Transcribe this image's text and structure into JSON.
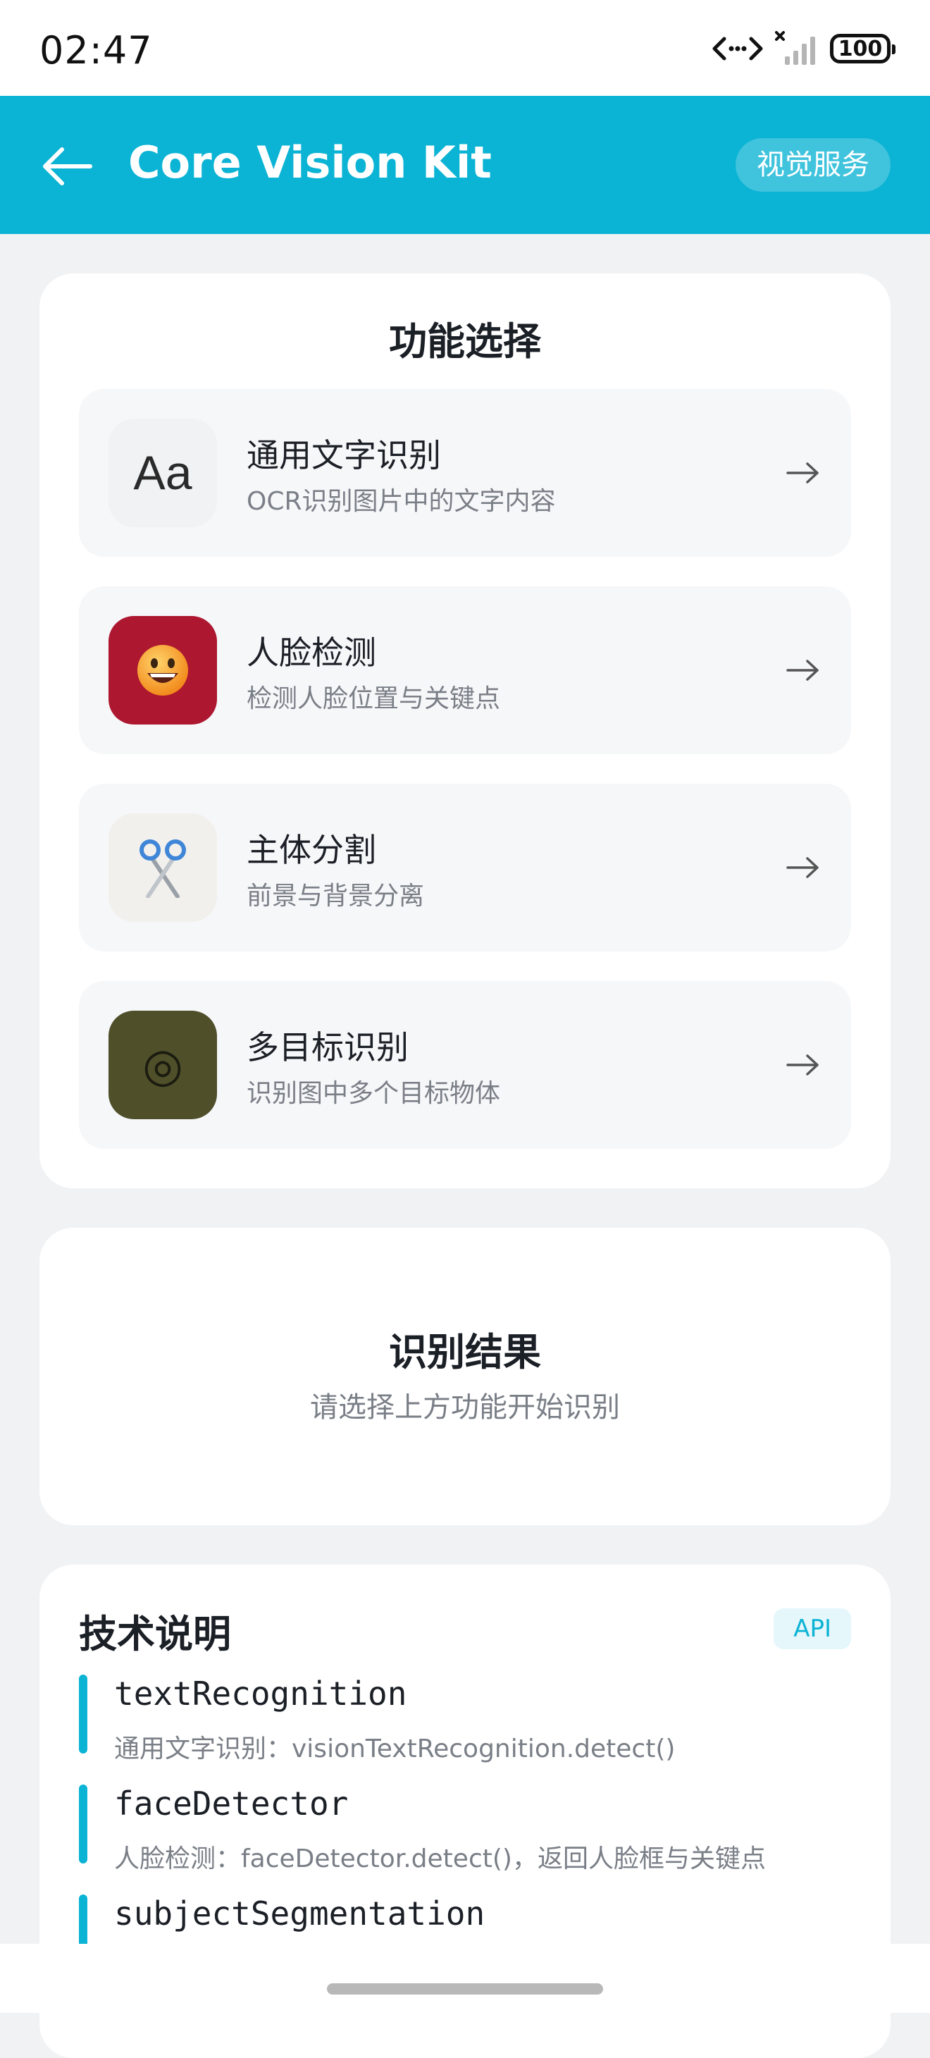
{
  "status_bar": {
    "time": "02:47",
    "battery": "100"
  },
  "header": {
    "title": "Core Vision Kit",
    "badge": "视觉服务"
  },
  "functions": {
    "title": "功能选择",
    "items": [
      {
        "label": "通用文字识别",
        "desc": "OCR识别图片中的文字内容",
        "icon_text": "Aa",
        "icon": "text-aa-icon",
        "icon_bg": "#f1f2f4"
      },
      {
        "label": "人脸检测",
        "desc": "检测人脸位置与关键点",
        "icon": "grinning-face-icon",
        "icon_bg": "#ad1730"
      },
      {
        "label": "主体分割",
        "desc": "前景与背景分离",
        "icon": "scissors-icon",
        "icon_bg": "#f2f0ec"
      },
      {
        "label": "多目标识别",
        "desc": "识别图中多个目标物体",
        "icon_text": "◎",
        "icon": "target-icon",
        "icon_bg": "#4f4f2a"
      }
    ]
  },
  "result": {
    "title": "识别结果",
    "hint": "请选择上方功能开始识别"
  },
  "tech": {
    "title": "技术说明",
    "badge": "API",
    "items": [
      {
        "name": "textRecognition",
        "desc": "通用文字识别：visionTextRecognition.detect()"
      },
      {
        "name": "faceDetector",
        "desc": "人脸检测：faceDetector.detect()，返回人脸框与关键点"
      },
      {
        "name": "subjectSegmentation",
        "desc": ""
      }
    ]
  },
  "colors": {
    "accent": "#0bb3d4",
    "background": "#f1f2f4"
  }
}
